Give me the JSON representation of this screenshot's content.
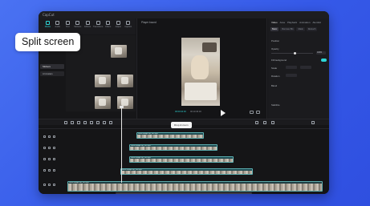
{
  "callout": {
    "label": "Split screen"
  },
  "app": {
    "logo": "CapCut"
  },
  "toolbar": {
    "items": [
      {
        "label": "Media",
        "active": true
      },
      {
        "label": "Audio"
      },
      {
        "label": "Text"
      },
      {
        "label": "Stickers"
      },
      {
        "label": "Effects"
      },
      {
        "label": "Transitions"
      },
      {
        "label": "Filters"
      },
      {
        "label": "Adjust"
      },
      {
        "label": "Caption"
      }
    ]
  },
  "sidebar": {
    "items": [
      {
        "label": "Stickers",
        "selected": true
      },
      {
        "label": "AI Avatars"
      }
    ]
  },
  "player": {
    "title": "Player bound",
    "timecode": "00:00:04:03",
    "duration": "00:10:36:03"
  },
  "inspector": {
    "tabs": [
      "Video",
      "Area",
      "Playback",
      "Animation",
      "Alembic"
    ],
    "subtabs": [
      "Basic",
      "Remove BG",
      "Mask",
      "Retouch"
    ],
    "rows": {
      "position": "Position",
      "opacity": "Opacity",
      "opacity_value": "100%",
      "background": "Fill background",
      "scale": "Scale",
      "rotation": "Rotation",
      "blend": "Blend",
      "stabilize": "Stabilize"
    }
  },
  "timeline": {
    "tooltip": "Drop & zoom",
    "clips": [
      {
        "name": "Stock footage clip_001.mp4"
      },
      {
        "name": "Stock footage clip_002.mp4"
      },
      {
        "name": "Stock footage clip_003.mp4"
      },
      {
        "name": "Stock footage clip_004.mp4"
      },
      {
        "name": "Stock footage clip_005.mp4"
      }
    ],
    "main_track_label": "Cover"
  },
  "colors": {
    "accent": "#2dd6d6",
    "background": "#3a60ee",
    "window": "#161618"
  }
}
